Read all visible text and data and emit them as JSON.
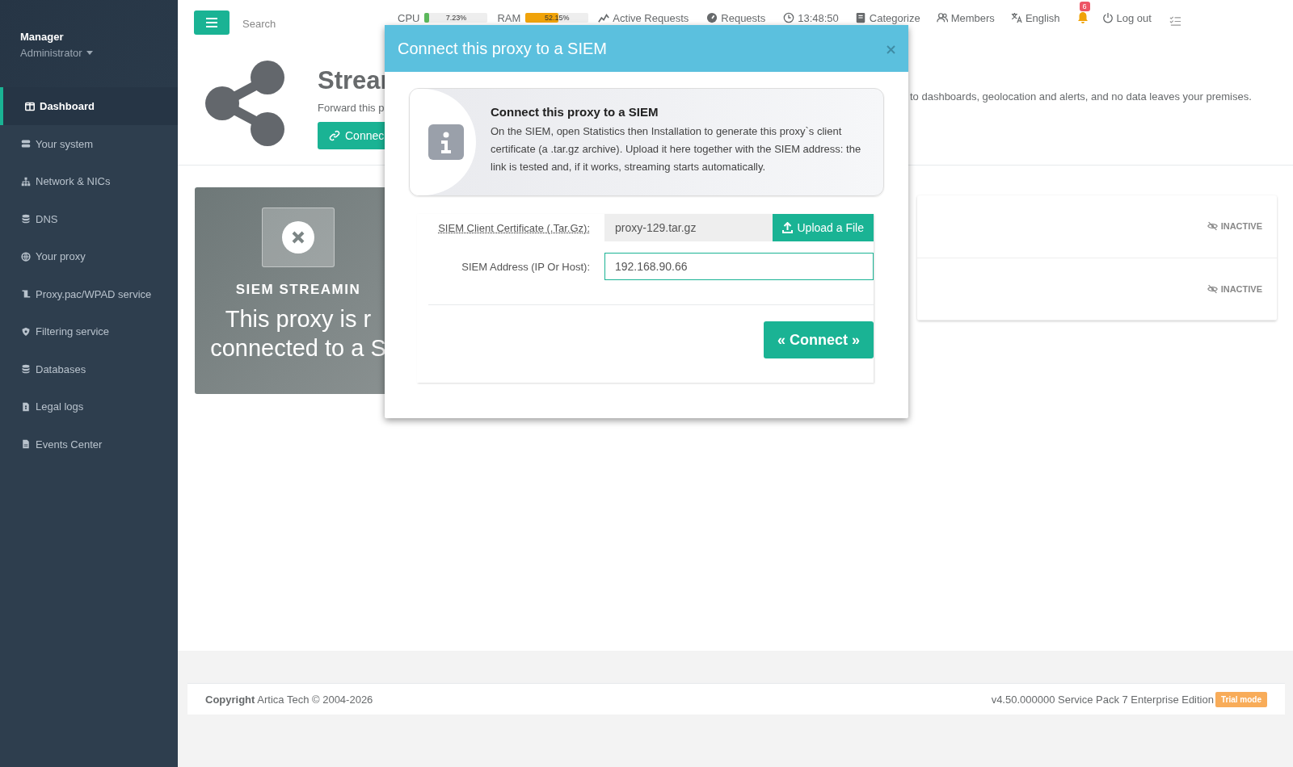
{
  "sidebar": {
    "user": "Manager",
    "role": "Administrator",
    "items": [
      {
        "label": "Dashboard",
        "selected": true
      },
      {
        "label": "Your system",
        "selected": false
      },
      {
        "label": "Network & NICs",
        "selected": false
      },
      {
        "label": "DNS",
        "selected": false
      },
      {
        "label": "Your proxy",
        "selected": false
      },
      {
        "label": "Proxy.pac/WPAD service",
        "selected": false
      },
      {
        "label": "Filtering service",
        "selected": false
      },
      {
        "label": "Databases",
        "selected": false
      },
      {
        "label": "Legal logs",
        "selected": false
      },
      {
        "label": "Events Center",
        "selected": false
      }
    ]
  },
  "topbar": {
    "search": {
      "placeholder": "Search"
    },
    "meters": [
      {
        "label": "CPU",
        "reading": "7.23%",
        "level": 0.07,
        "color": "#5cb85c"
      },
      {
        "label": "RAM",
        "reading": "52.15%",
        "level": 0.52,
        "color": "#f0a30a"
      }
    ],
    "items": [
      {
        "label": "Active Requests"
      },
      {
        "label": "Requests"
      },
      {
        "label": "13:48:50"
      },
      {
        "label": "Categorize"
      },
      {
        "label": "Members"
      },
      {
        "label": "English"
      }
    ],
    "notifications": "6",
    "logout": "Log out"
  },
  "page": {
    "title": "Strear",
    "description": "Forward this p",
    "description_end": "to dashboards, geolocation and alerts, and no data leaves your premises.",
    "button": "Connec"
  },
  "status_card": {
    "heading": "SIEM STREAMIN",
    "message": [
      "This proxy is r",
      "connected to a S"
    ]
  },
  "services": [
    {
      "status": "INACTIVE"
    },
    {
      "status": "INACTIVE"
    }
  ],
  "modal": {
    "title": "Connect this proxy to a SIEM",
    "info": {
      "title": "Connect this proxy to a SIEM",
      "text": "On the SIEM, open Statistics then Installation to generate this proxy`s client certificate (a .tar.gz archive). Upload it here together with the SIEM address: the link is tested and, if it works, streaming starts automatically."
    },
    "certificate": {
      "label": "SIEM Client Certificate (.Tar.Gz):",
      "value": "proxy-129.tar.gz",
      "button": "Upload a File"
    },
    "address": {
      "label": "SIEM Address (IP Or Host):",
      "value": "192.168.90.66"
    },
    "submit": "« Connect »"
  },
  "footer": {
    "copyright_label": "Copyright",
    "copyright": "Artica Tech © 2004-2026",
    "version": "v4.50.000000 Service Pack 7 Enterprise Edition",
    "badge": "Trial mode"
  }
}
